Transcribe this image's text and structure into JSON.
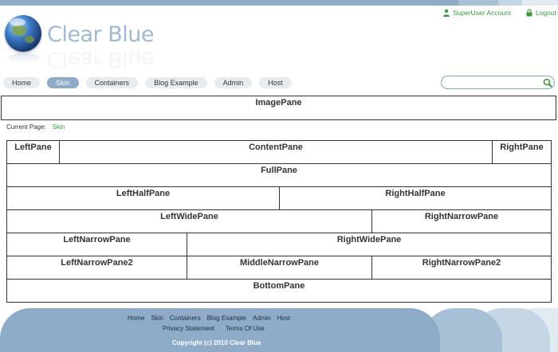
{
  "account": {
    "user_label": "SuperUser Account",
    "logout_label": "Logout"
  },
  "logo": {
    "text": "Clear Blue"
  },
  "nav": {
    "items": [
      "Home",
      "Skin",
      "Containers",
      "Blog Example",
      "Admin",
      "Host"
    ],
    "active": "Skin"
  },
  "search": {
    "value": "",
    "placeholder": ""
  },
  "image_pane": "ImagePane",
  "current_page": {
    "label": "Current Page:",
    "value": "Skin"
  },
  "panes": {
    "left": "LeftPane",
    "content": "ContentPane",
    "right": "RightPane",
    "full": "FullPane",
    "left_half": "LeftHalfPane",
    "right_half": "RightHalfPane",
    "left_wide": "LeftWidePane",
    "right_narrow": "RightNarrowPane",
    "left_narrow": "LeftNarrowPane",
    "right_wide": "RightWidePane",
    "left_narrow2": "LeftNarrowPane2",
    "middle_narrow": "MiddleNarrowPane",
    "right_narrow2": "RightNarrowPane2",
    "bottom": "BottomPane"
  },
  "footer": {
    "links": [
      "Home",
      "Skin",
      "Containers",
      "Blog Example",
      "Admin",
      "Host"
    ],
    "privacy": "Privacy Statement",
    "terms": "Terms Of Use",
    "copyright": "Copyright (c) 2010 Clear Blue"
  },
  "colors": {
    "accent": "#8eabc7",
    "link_green": "#3a9a3a",
    "border": "#333333"
  }
}
